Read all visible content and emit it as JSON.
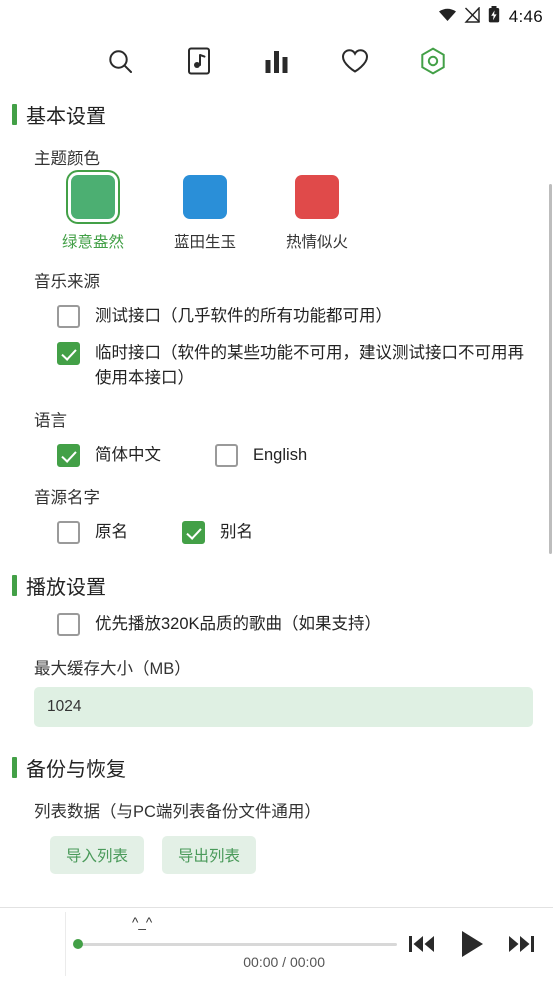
{
  "statusbar": {
    "time": "4:46",
    "icons": [
      "wifi-icon",
      "signal-off-icon",
      "battery-charging-icon"
    ]
  },
  "topbar": {
    "items": [
      {
        "name": "search-icon",
        "label": "搜索"
      },
      {
        "name": "song-list-icon",
        "label": "歌单"
      },
      {
        "name": "leaderboard-icon",
        "label": "排行榜"
      },
      {
        "name": "heart-icon",
        "label": "收藏"
      },
      {
        "name": "settings-icon",
        "label": "设置"
      }
    ]
  },
  "settings": {
    "basic": {
      "title": "基本设置",
      "theme": {
        "label": "主题颜色",
        "options": [
          {
            "name": "绿意盎然",
            "color": "#4caf72",
            "selected": true
          },
          {
            "name": "蓝田生玉",
            "color": "#2a8fd8",
            "selected": false
          },
          {
            "name": "热情似火",
            "color": "#e04a4a",
            "selected": false
          }
        ]
      },
      "source": {
        "label": "音乐来源",
        "options": [
          {
            "label": "测试接口（几乎软件的所有功能都可用）",
            "checked": false
          },
          {
            "label": "临时接口（软件的某些功能不可用，建议测试接口不可用再使用本接口）",
            "checked": true
          }
        ]
      },
      "language": {
        "label": "语言",
        "options": [
          {
            "label": "简体中文",
            "checked": true
          },
          {
            "label": "English",
            "checked": false
          }
        ]
      },
      "source_name": {
        "label": "音源名字",
        "options": [
          {
            "label": "原名",
            "checked": false
          },
          {
            "label": "别名",
            "checked": true
          }
        ]
      }
    },
    "playback": {
      "title": "播放设置",
      "options": [
        {
          "label": "优先播放320K品质的歌曲（如果支持）",
          "checked": false
        }
      ],
      "cache": {
        "label": "最大缓存大小（MB）",
        "value": "1024"
      }
    },
    "backup": {
      "title": "备份与恢复",
      "list_label": "列表数据（与PC端列表备份文件通用）",
      "buttons": [
        {
          "label": "导入列表"
        },
        {
          "label": "导出列表"
        }
      ]
    }
  },
  "player": {
    "track": "^_^",
    "time": "00:00 / 00:00",
    "controls": [
      {
        "name": "previous-button"
      },
      {
        "name": "play-button"
      },
      {
        "name": "next-button"
      }
    ]
  },
  "colors": {
    "accent": "#43a047",
    "input_bg": "#dff0e3",
    "button_bg": "#e3f0e6"
  }
}
